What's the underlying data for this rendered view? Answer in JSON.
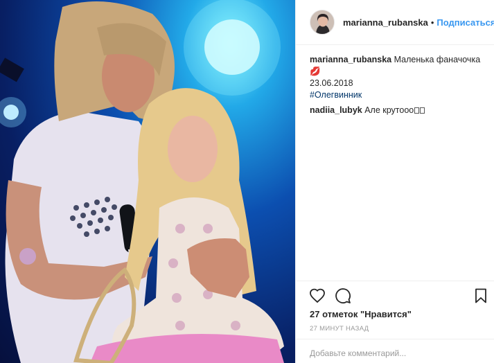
{
  "header": {
    "username": "marianna_rubanska",
    "separator": "•",
    "follow_label": "Подписаться"
  },
  "caption": {
    "username": "marianna_rubanska",
    "text": "Маленька фаначочка💋",
    "date": "23.06.2018",
    "hashtag": "#Олегвинник"
  },
  "comments": [
    {
      "username": "nadiia_lubyk",
      "text": "Але крутооо"
    }
  ],
  "icons": {
    "like": "heart-icon",
    "comment": "comment-bubble-icon",
    "save": "bookmark-icon"
  },
  "likes_text": "27 отметок \"Нравится\"",
  "timestamp": "27 МИНУТ НАЗАД",
  "add_comment": {
    "placeholder": "Добавьте комментарий..."
  },
  "colors": {
    "link_blue": "#3897f0",
    "hashtag_blue": "#003569",
    "muted_gray": "#999999",
    "border": "#efefef"
  }
}
